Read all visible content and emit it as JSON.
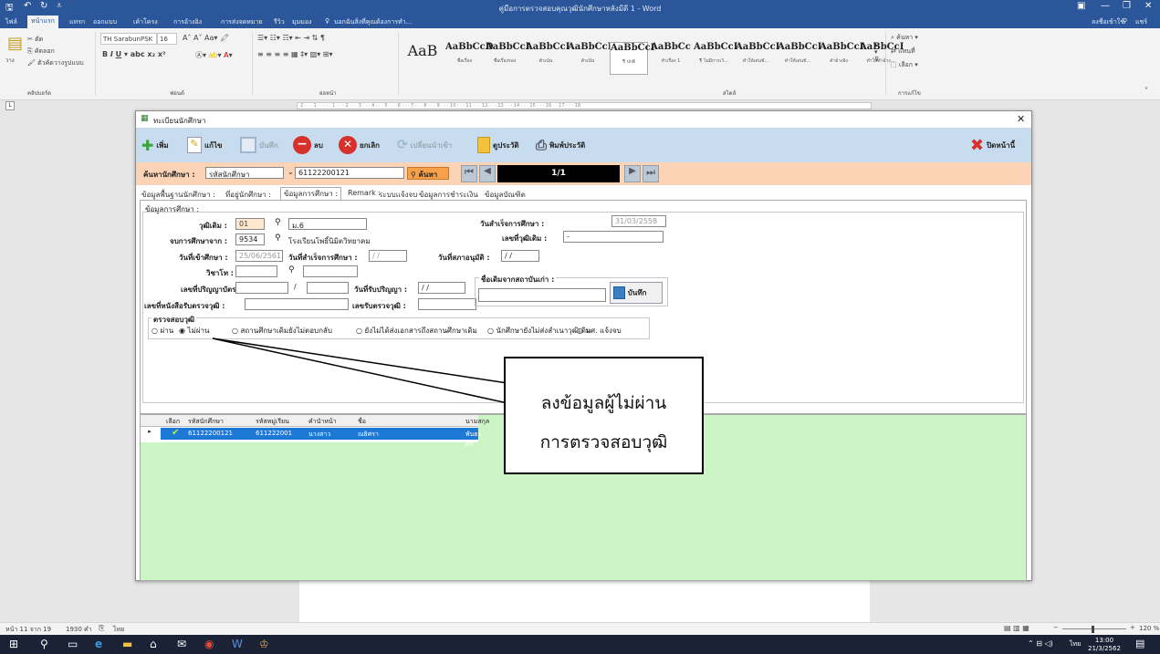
{
  "word": {
    "title": "คู่มือการตรวจสอบคุณวุฒินักศึกษาหลังมีดี 1 - Word",
    "signin": "ลงชื่อเข้าใช้",
    "share": "แชร์",
    "menu": [
      "ไฟล์",
      "หน้าแรก",
      "แทรก",
      "ออกแบบ",
      "เค้าโครง",
      "การอ้างอิง",
      "การส่งจดหมาย",
      "รีวิว",
      "มุมมอง"
    ],
    "tellme": "บอกฉันสิ่งที่คุณต้องการทำ...",
    "font": "TH SarabunPSK",
    "size": "16",
    "groups": [
      "คลิปบอร์ด",
      "ฟอนต์",
      "ย่อหน้า",
      "สไตล์",
      "การแก้ไข"
    ],
    "clipboard": [
      "ตัด",
      "คัดลอก",
      "ตัวคัดวางรูปแบบ"
    ],
    "styles": [
      {
        "sample": "AaB",
        "name": ""
      },
      {
        "sample": "AaBbCcD",
        "name": "ชื่อเรื่อง"
      },
      {
        "sample": "AaBbCcI",
        "name": "ชื่อเรื่องรอง"
      },
      {
        "sample": "AaBbCcI",
        "name": "ตัวเน้น"
      },
      {
        "sample": "AaBbCcI",
        "name": "ตัวเน้น"
      },
      {
        "sample": "AaBbCcI",
        "name": "¶ ปกติ"
      },
      {
        "sample": "AaBbCc",
        "name": "หัวเรื่อง 1"
      },
      {
        "sample": "AaBbCcI",
        "name": "¶ ไม่มีการเว้..."
      },
      {
        "sample": "AaBbCcI",
        "name": "ทำให้เด่นชั..."
      },
      {
        "sample": "AaBbCcI",
        "name": "ทำให้เด่นชั..."
      },
      {
        "sample": "AaBbCcI",
        "name": "คำอ้างอิง"
      },
      {
        "sample": "AaBbCcI",
        "name": "ทำให้คำอ้าง..."
      },
      {
        "sample": "AABBCC",
        "name": "ทำให้การอ้า..."
      },
      {
        "sample": "AABBCC",
        "name": "ทำให้การอ้า..."
      },
      {
        "sample": "AaBbCc",
        "name": "ชื่อหนังสือ"
      },
      {
        "sample": "AaBbCcI",
        "name": "¶ รายการย่อ..."
      }
    ],
    "editing": [
      "ค้นหา",
      "แทนที่",
      "เลือก"
    ],
    "ruler": "· 2 · · · 1 · · · · · 1 · · · 2 · · · 3 · · · 4 · · · 5 · · · 6 · · · 7 · · · 8 · · · 9 · · · 10 · · · 11 · · · 12 · · · 13 · · · 14 · · · 15 · · · 16 · · 17 · · · 18",
    "status": {
      "page": "หน้า 11 จาก 19",
      "words": "1930 คำ",
      "lang": "ไทย",
      "zoom": "120 %"
    },
    "clock": {
      "time": "13:00",
      "date": "21/3/2562",
      "lang": "ไทย"
    }
  },
  "dialog": {
    "title": "ทะเบียนนักศึกษา",
    "toolbar": [
      {
        "label": "เพิ่ม",
        "icon": "plus-icon",
        "enabled": true
      },
      {
        "label": "แก้ไข",
        "icon": "pencil-icon",
        "enabled": true
      },
      {
        "label": "บันทึก",
        "icon": "save-icon",
        "enabled": false
      },
      {
        "label": "ลบ",
        "icon": "delete-icon",
        "enabled": true
      },
      {
        "label": "ยกเลิก",
        "icon": "cancel-icon",
        "enabled": true
      },
      {
        "label": "เปลี่ยนนำเข้า",
        "icon": "refresh-icon",
        "enabled": false
      },
      {
        "label": "ดูประวัติ",
        "icon": "folder-icon",
        "enabled": true
      },
      {
        "label": "พิมพ์ประวัติ",
        "icon": "printer-icon",
        "enabled": true
      }
    ],
    "close_label": "ปิดหน้านี้",
    "search": {
      "label": "ค้นหานักศึกษา :",
      "by": "รหัสนักศึกษา",
      "value": "61122200121",
      "button": "ค้นหา",
      "record": "1/1"
    },
    "tabs": [
      "ข้อมูลพื้นฐานนักศึกษา :",
      "ที่อยู่นักศึกษา :",
      "ข้อมูลการศึกษา :",
      "Remark :",
      "ระบบแจ้งจบ",
      "ข้อมูลการชำระเงิน",
      "ข้อมูลบัณฑิต"
    ],
    "section": "ข้อมูลการศึกษา :",
    "form": {
      "degree_label": "วุฒิเดิม :",
      "degree_code": "01",
      "degree_name": "ม.6",
      "grad_from_label": "จบการศึกษาจาก :",
      "school_code": "9534",
      "school_name": "โรงเรียนโพธิ์นิมิตวิทยาคม",
      "enroll_label": "วันที่เข้าศึกษา :",
      "enroll_date": "25/06/2561",
      "finish_label": "วันที่สำเร็จการศึกษา :",
      "finish_value": "/ /",
      "approve_label": "วันที่สภาอนุมัติ :",
      "approve_value": "/ /",
      "major_label": "วิชาโท :",
      "cert_label": "เลขที่ปริญญาบัตร :",
      "cert_sep": "/",
      "cert_date_label": "วันที่รับปริญญา :",
      "cert_date_value": "/ /",
      "verify_doc_label": "เลขที่หนังสือรับตรวจวุฒิ :",
      "verify_no_label": "เลขรับตรวจวุฒิ :",
      "prev_grad_label": "วันสำเร็จการศึกษา :",
      "prev_grad_value": "31/03/2558",
      "prev_degree_no_label": "เลขที่วุฒิเดิม :",
      "prev_degree_no_value": "-",
      "prev_name_label": "ชื่อเดิมจากสถาบันเก่า :",
      "save_label": "บันทึก"
    },
    "verify": {
      "title": "ตรวจสอบวุฒิ",
      "options": [
        "ผ่าน",
        "ไม่ผ่าน",
        "สถานศึกษาเดิมยังไม่ตอบกลับ",
        "ยังไม่ได้ส่งเอกสารถึงสถานศึกษาเดิม",
        "นักศึกษายังไม่ส่งสำเนาวุฒิเดิม",
        "นศ. แจ้งจบ"
      ],
      "selected": 1
    },
    "grid": {
      "columns": [
        "เลือก",
        "รหัสนักศึกษา",
        "รหัสหมู่เรียน",
        "คำนำหน้า",
        "ชื่อ",
        "นามสกุล"
      ],
      "row": {
        "student_id": "61122200121",
        "group_id": "611222001",
        "prefix": "นางสาว",
        "first": "ณธิศรา",
        "last": "พันธะศรี"
      }
    }
  },
  "callout": {
    "line1": "ลงข้อมูลผู้ไม่ผ่าน",
    "line2": "การตรวจสอบวุฒิ"
  },
  "colors": {
    "word_blue": "#2b579a",
    "toolbar": "#c7ddef",
    "search": "#fcd3b4",
    "grid": "#ccf5c5",
    "selected_row": "#1e78d6"
  }
}
